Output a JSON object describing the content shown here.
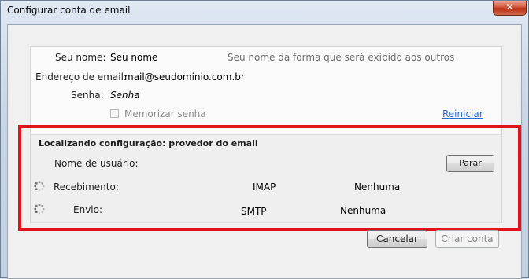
{
  "window": {
    "title": "Configurar conta de email",
    "close_glyph": "✕"
  },
  "form": {
    "name_label": "Seu nome:",
    "name_value": "Seu nome",
    "name_hint": "Seu nome da forma que será exibido aos outros",
    "email_label": "Endereço de email:",
    "email_value": "mail@seudominio.com.br",
    "password_label": "Senha:",
    "password_placeholder": "Senha",
    "remember_label": "Memorizar senha",
    "remember_checked": false,
    "restart_link": "Reiniciar"
  },
  "status": {
    "title": "Localizando configuração: provedor do email",
    "username_label": "Nome de usuário:",
    "stop_button": "Parar",
    "incoming_label": "Recebimento:",
    "incoming_protocol": "IMAP",
    "incoming_security": "Nenhuma",
    "outgoing_label": "Envio:",
    "outgoing_protocol": "SMTP",
    "outgoing_security": "Nenhuma"
  },
  "buttons": {
    "cancel": "Cancelar",
    "create": "Criar conta"
  },
  "colors": {
    "highlight": "#e1121c",
    "link": "#2a6bcc"
  }
}
